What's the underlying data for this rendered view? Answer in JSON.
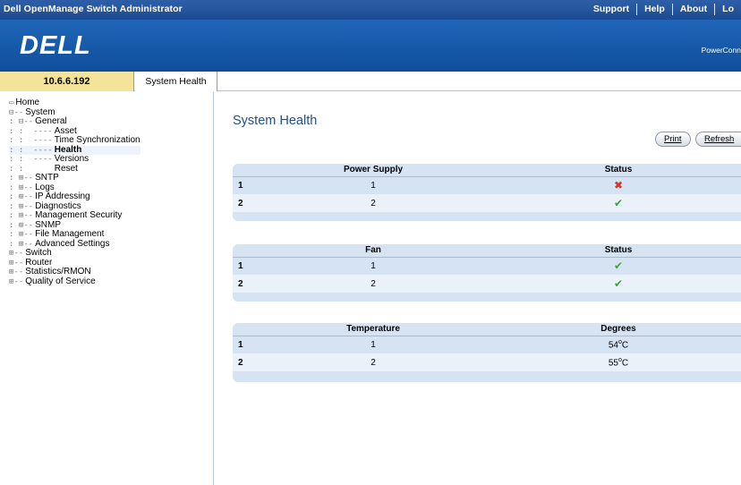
{
  "app_title": "Dell OpenManage Switch Administrator",
  "top_links": [
    "Support",
    "Help",
    "About",
    "Lo"
  ],
  "brand": {
    "logo": "DELL",
    "product": "PowerConn"
  },
  "address": {
    "ip": "10.6.6.192",
    "tab": "System Health"
  },
  "tree": {
    "home": "Home",
    "system": "System",
    "general": "General",
    "asset": "Asset",
    "time_sync": "Time Synchronization",
    "health": "Health",
    "versions": "Versions",
    "reset": "Reset",
    "sntp": "SNTP",
    "logs": "Logs",
    "ip_addressing": "IP Addressing",
    "diagnostics": "Diagnostics",
    "mgmt_security": "Management Security",
    "snmp": "SNMP",
    "file_mgmt": "File Management",
    "adv_settings": "Advanced Settings",
    "switch": "Switch",
    "router": "Router",
    "statistics": "Statistics/RMON",
    "qos": "Quality of Service"
  },
  "main": {
    "title": "System Health",
    "print_label": "Print",
    "refresh_label": "Refresh"
  },
  "power": {
    "headers": [
      "",
      "Power Supply",
      "Status"
    ],
    "rows": [
      {
        "idx": "1",
        "unit": "1",
        "status": "fail"
      },
      {
        "idx": "2",
        "unit": "2",
        "status": "ok"
      }
    ]
  },
  "fan": {
    "headers": [
      "",
      "Fan",
      "Status"
    ],
    "rows": [
      {
        "idx": "1",
        "unit": "1",
        "status": "ok"
      },
      {
        "idx": "2",
        "unit": "2",
        "status": "ok"
      }
    ]
  },
  "temp": {
    "headers": [
      "",
      "Temperature",
      "Degrees"
    ],
    "rows": [
      {
        "idx": "1",
        "unit": "1",
        "value": "54",
        "unit_label": "C"
      },
      {
        "idx": "2",
        "unit": "2",
        "value": "55",
        "unit_label": "C"
      }
    ]
  },
  "colors": {
    "title_blue": "#244f8a",
    "panel": "#d6e3f2",
    "ok": "#3aa53a",
    "fail": "#d6342a"
  }
}
